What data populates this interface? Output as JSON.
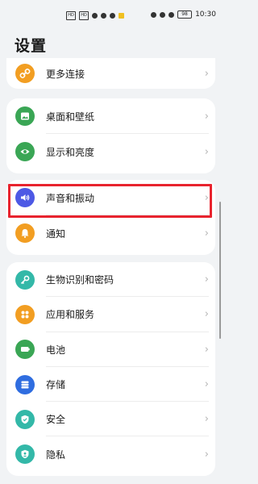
{
  "status": {
    "left_icons": [
      "sim-hd-icon",
      "sim-hd-icon",
      "wifi-icon",
      "chat-icon",
      "chat-icon",
      "notify-icon"
    ],
    "right_icons": [
      "alarm-icon",
      "bluetooth-icon",
      "mute-icon"
    ],
    "battery": "98",
    "time": "10:30"
  },
  "title": "设置",
  "groups": {
    "g1": [
      {
        "label": "更多连接",
        "icon": "link-icon",
        "color": "#f29e22"
      }
    ],
    "g2": [
      {
        "label": "桌面和壁纸",
        "icon": "image-icon",
        "color": "#3aa655"
      },
      {
        "label": "显示和亮度",
        "icon": "eye-icon",
        "color": "#3aa655"
      }
    ],
    "g3": [
      {
        "label": "声音和振动",
        "icon": "speaker-icon",
        "color": "#4d59e5"
      },
      {
        "label": "通知",
        "icon": "bell-icon",
        "color": "#f29e22"
      }
    ],
    "g4": [
      {
        "label": "生物识别和密码",
        "icon": "key-icon",
        "color": "#33b8a8"
      },
      {
        "label": "应用和服务",
        "icon": "apps-icon",
        "color": "#f29e22"
      },
      {
        "label": "电池",
        "icon": "battery-icon",
        "color": "#3aa655"
      },
      {
        "label": "存储",
        "icon": "storage-icon",
        "color": "#2f6de0"
      },
      {
        "label": "安全",
        "icon": "shield-icon",
        "color": "#33b8a8"
      },
      {
        "label": "隐私",
        "icon": "privacy-icon",
        "color": "#33b8a8"
      }
    ]
  },
  "chevron": "›",
  "highlight_color": "#e8232e"
}
